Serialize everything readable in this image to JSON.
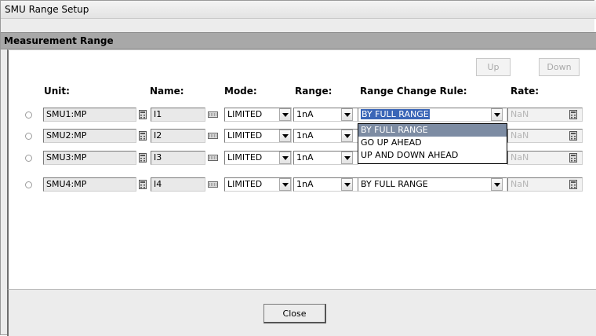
{
  "window": {
    "title": "SMU Range Setup"
  },
  "section": {
    "title": "Measurement Range"
  },
  "toolbar": {
    "up_label": "Up",
    "down_label": "Down"
  },
  "columns": {
    "unit": "Unit:",
    "name": "Name:",
    "mode": "Mode:",
    "range": "Range:",
    "rule": "Range Change Rule:",
    "rate": "Rate:"
  },
  "rows": [
    {
      "unit": "SMU1:MP",
      "name": "I1",
      "mode": "LIMITED",
      "range": "1nA",
      "rule": "BY FULL RANGE",
      "rate": "NaN"
    },
    {
      "unit": "SMU2:MP",
      "name": "I2",
      "mode": "LIMITED",
      "range": "1nA",
      "rule": "",
      "rate": "NaN"
    },
    {
      "unit": "SMU3:MP",
      "name": "I3",
      "mode": "LIMITED",
      "range": "1nA",
      "rule": "",
      "rate": "NaN"
    },
    {
      "unit": "SMU4:MP",
      "name": "I4",
      "mode": "LIMITED",
      "range": "1nA",
      "rule": "BY FULL RANGE",
      "rate": "NaN"
    }
  ],
  "rule_dropdown": {
    "options": [
      "BY FULL RANGE",
      "GO UP AHEAD",
      "UP AND DOWN AHEAD"
    ],
    "selected": "BY FULL RANGE"
  },
  "footer": {
    "close_label": "Close"
  },
  "colors": {
    "section_header": "#a8a8a8",
    "selection": "#3a66b7",
    "list_highlight": "#7d8ca3"
  },
  "icons": {
    "unit_picker": "calculator-icon",
    "name_picker": "keyboard-icon",
    "rate_picker": "calculator-icon"
  }
}
